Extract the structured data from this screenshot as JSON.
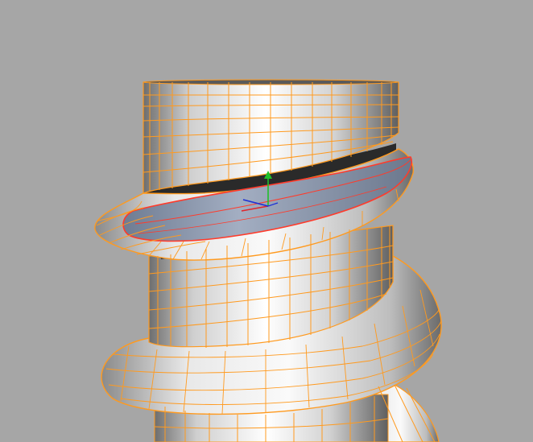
{
  "viewport": {
    "background": "#a6a6a6",
    "wire_color": "#ff9a1f",
    "selection_color": "#ff3b2b",
    "selected_face_color": "#8e9aae",
    "gizmo": {
      "x_axis_color": "#e0252b",
      "y_axis_color": "#1fbf2a",
      "z_axis_color": "#1c2fd6"
    }
  }
}
